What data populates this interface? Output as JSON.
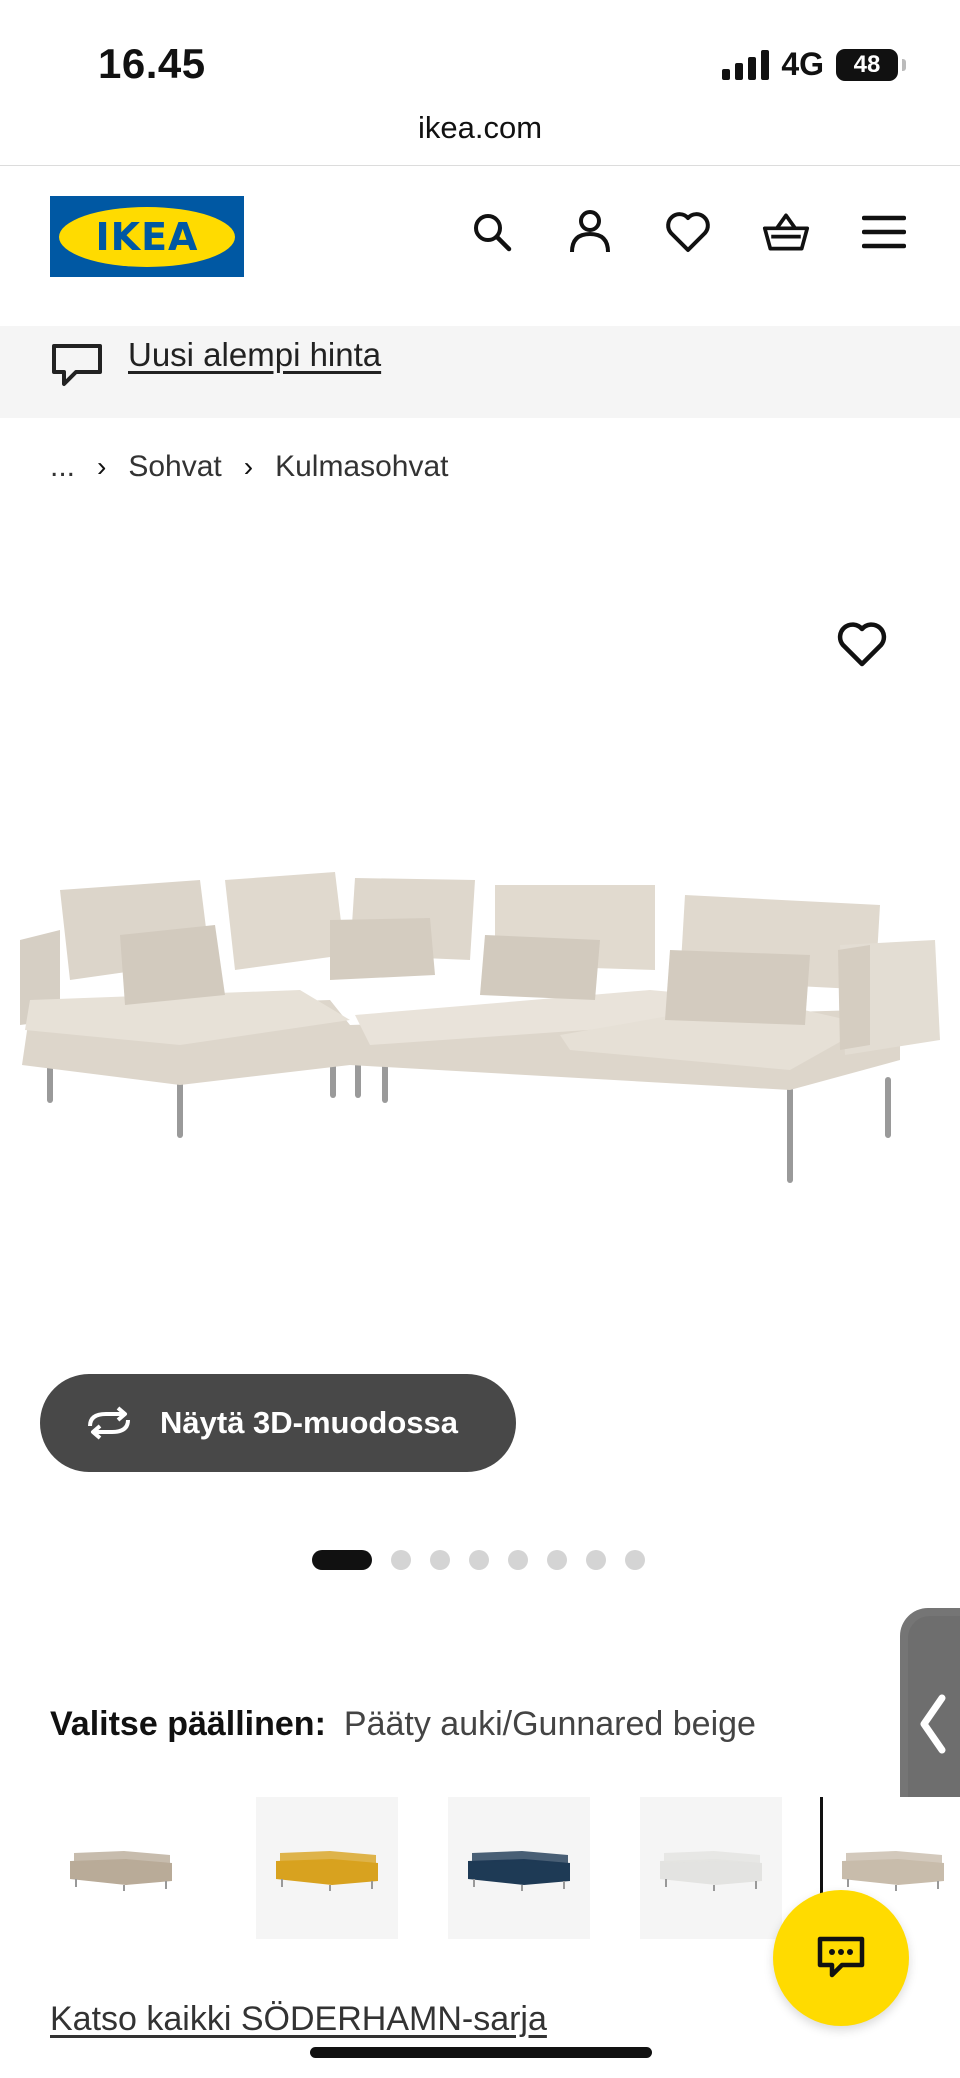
{
  "status_bar": {
    "time": "16.45",
    "network": "4G",
    "battery": "48"
  },
  "browser": {
    "url": "ikea.com"
  },
  "header": {
    "logo_text": "IKEA",
    "icons": [
      "search-icon",
      "profile-icon",
      "heart-icon",
      "basket-icon",
      "menu-icon"
    ]
  },
  "notice": {
    "text": "Uusi alempi hinta"
  },
  "breadcrumb": {
    "ellipsis": "...",
    "items": [
      "Sohvat",
      "Kulmasohvat"
    ]
  },
  "gallery": {
    "view_3d_label": "Näytä 3D-muodossa",
    "slide_count": 8,
    "active_slide": 1
  },
  "variant": {
    "label": "Valitse päällinen:",
    "value": "Pääty auki/Gunnared beige",
    "swatch_colors": [
      "#b9ab98",
      "#d8a21f",
      "#1e3a55",
      "#e3e3e1",
      "#c8bcab"
    ]
  },
  "series_link": "Katso kaikki SÖDERHAMN-sarja",
  "colors": {
    "brand_blue": "#0058a3",
    "brand_yellow": "#ffdb00",
    "button_dark": "#484848"
  }
}
